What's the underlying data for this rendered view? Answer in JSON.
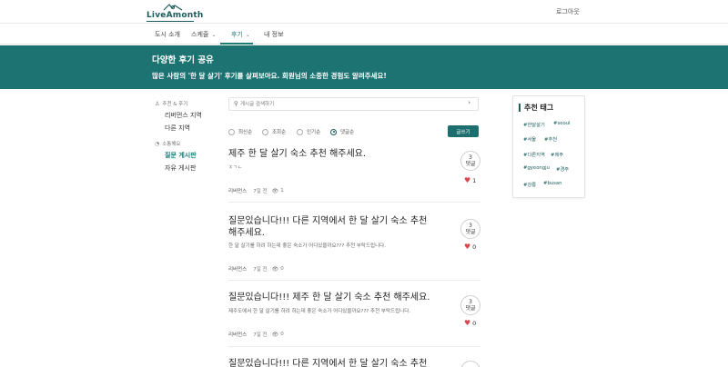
{
  "header": {
    "logo_text": "LiveAmonth",
    "logout_label": "로그아웃"
  },
  "nav": {
    "items": [
      {
        "label": "도시 소개",
        "has_dropdown": false
      },
      {
        "label": "스케줄",
        "has_dropdown": true
      },
      {
        "label": "후기",
        "has_dropdown": true,
        "active": true
      },
      {
        "label": "내 정보",
        "has_dropdown": false
      }
    ]
  },
  "banner": {
    "title": "다양한 후기 공유",
    "subtitle": "많은 사람의 '한 달 살기' 후기를 살펴보아요. 회원님의 소중한 경험도 알려주세요!"
  },
  "sidebar": {
    "groups": [
      {
        "label": "추천 & 후기",
        "items": [
          "리버먼스 지역",
          "다른 지역"
        ]
      },
      {
        "label": "소통해요",
        "items": [
          "질문 게시판",
          "자유 게시판"
        ],
        "active_index": 0
      }
    ]
  },
  "search": {
    "placeholder": "게시글 검색하기"
  },
  "sort": {
    "options": [
      "최신순",
      "조회순",
      "인기순",
      "댓글순"
    ],
    "selected": "댓글순",
    "write_label": "글쓰기"
  },
  "posts": [
    {
      "title": "제주 한 달 살기 숙소 추천 해주세요.",
      "body": "ㅈㄱㄴ",
      "author": "리버먼스",
      "date": "7일 전",
      "views": "1",
      "comments": "3",
      "comment_label": "댓글",
      "likes": "1",
      "liked": true
    },
    {
      "title": "질문있습니다!!! 다른 지역에서 한 달 살기 숙소 추천 해주세요.",
      "body": "한 달 살기를 하려 하는데 좋은 숙소가 어디있을까요??? 추천 부탁드립니다.",
      "author": "리버먼스",
      "date": "7일 전",
      "views": "0",
      "comments": "3",
      "comment_label": "댓글",
      "likes": "0",
      "liked": false
    },
    {
      "title": "질문있습니다!!! 제주 한 달 살기 숙소 추천 해주세요.",
      "body": "제주도에서 한 달 살기를 하려 하는데 좋은 숙소가 어디있을까요??? 추천 부탁드립니다.",
      "author": "리버먼스",
      "date": "7일 전",
      "views": "0",
      "comments": "3",
      "comment_label": "댓글",
      "likes": "0",
      "liked": false
    },
    {
      "title": "질문있습니다!!! 다른 지역에서 한 달 살기 숙소 추천",
      "body": "",
      "author": "",
      "date": "",
      "views": "",
      "comments": "",
      "comment_label": "",
      "likes": "",
      "liked": false
    }
  ],
  "tags_panel": {
    "title": "추천 태그",
    "tags": [
      "#한달살기",
      "#seoul",
      "#서울",
      "#추천",
      "#다른지역",
      "#제주",
      "#gyeongju",
      "#경주",
      "#강릉",
      "#busan"
    ]
  },
  "colors": {
    "brand": "#1d7272",
    "accent_dark": "#1c5c5c",
    "heart": "#d9454f"
  },
  "icons": {
    "search": "search-icon",
    "eye": "eye-icon",
    "heart": "heart-icon",
    "chevron": "chevron-down-icon"
  }
}
